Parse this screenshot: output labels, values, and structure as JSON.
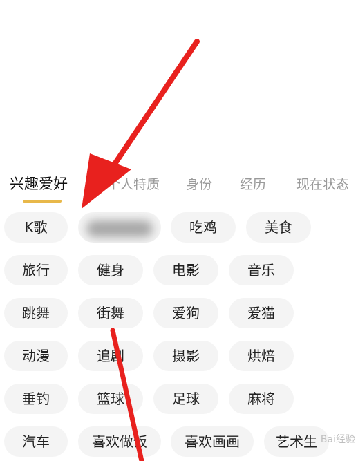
{
  "tabs": [
    {
      "label": "兴趣爱好",
      "active": true
    },
    {
      "label": "个人特质",
      "active": false
    },
    {
      "label": "身份",
      "active": false
    },
    {
      "label": "经历",
      "active": false
    },
    {
      "label": "现在状态",
      "active": false
    }
  ],
  "interests": [
    [
      "K歌",
      "",
      "吃鸡",
      "美食"
    ],
    [
      "旅行",
      "健身",
      "电影",
      "音乐"
    ],
    [
      "跳舞",
      "街舞",
      "爱狗",
      "爱猫"
    ],
    [
      "动漫",
      "追剧",
      "摄影",
      "烘焙"
    ],
    [
      "垂钓",
      "篮球",
      "足球",
      "麻将"
    ],
    [
      "汽车",
      "喜欢做饭",
      "喜欢画画",
      "艺术生"
    ]
  ],
  "colors": {
    "accent": "#e8b84a",
    "chip_bg": "#f4f4f4",
    "arrow": "#e8211e",
    "tab_inactive": "#9a9a9a"
  },
  "watermark": "Bai经验"
}
